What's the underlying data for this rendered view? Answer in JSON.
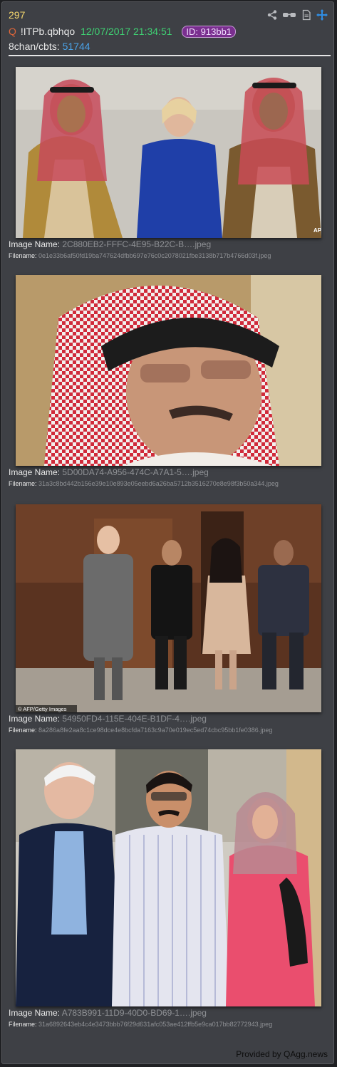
{
  "post": {
    "number": "297",
    "q_mark": "Q",
    "tripcode": "!ITPb.qbhqo",
    "timestamp": "12/07/2017 21:34:51",
    "id_badge": "ID: 913bb1",
    "board_label": "8chan/cbts:",
    "board_post": "51744"
  },
  "toolbar": {
    "icons": [
      "share-icon",
      "glasses-icon",
      "document-icon",
      "move-icon"
    ]
  },
  "images": [
    {
      "name_label": "Image Name:",
      "name_value": "2C880EB2-FFFC-4E95-B22C-B….jpeg",
      "file_label": "Filename:",
      "file_value": "0e1e33b6af50fd19ba747624dfbb697e76c0c2078021fbe3138b717b4766d03f.jpeg",
      "watermark": "AP"
    },
    {
      "name_label": "Image Name:",
      "name_value": "5D00DA74-A956-474C-A7A1-5….jpeg",
      "file_label": "Filename:",
      "file_value": "31a3c8bd442b156e39e10e893e05eebd6a26ba5712b3516270e8e98f3b50a344.jpeg"
    },
    {
      "name_label": "Image Name:",
      "name_value": "54950FD4-115E-404E-B1DF-4….jpeg",
      "file_label": "Filename:",
      "file_value": "8a286a8fe2aa8c1ce98dce4e8bcfda7163c9a70e019ec5ed74cbc95bb1fe0386.jpeg",
      "watermark": "© AFP/Getty Images"
    },
    {
      "name_label": "Image Name:",
      "name_value": "A783B991-11D9-40D0-BD69-1….jpeg",
      "file_label": "Filename:",
      "file_value": "31a6892643eb4c4e3473bbb76f29d631afc053ae412ffb5e9ca017bb82772943.jpeg"
    }
  ],
  "footer": {
    "text": "Provided by QAgg.news"
  },
  "colors": {
    "background": "#3e4045",
    "post_number": "#f5d76e",
    "q_mark": "#e0663a",
    "timestamp": "#3fd173",
    "id_badge": "#7a2f8f",
    "link": "#4aa3e8"
  }
}
